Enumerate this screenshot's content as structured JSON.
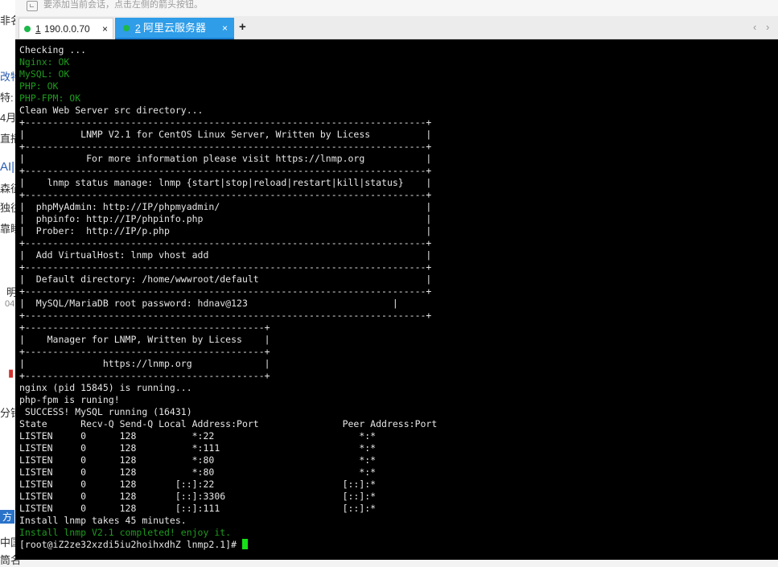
{
  "background": {
    "fragments": [
      "非名",
      "改特",
      "特:",
      "4月",
      "直播",
      "AI|狗",
      "森征",
      "独往",
      "靠睡",
      "明",
      "04",
      "分钟",
      "方",
      "中国",
      "筒名"
    ]
  },
  "hint": {
    "text": "要添加当前会话，点击左侧的箭头按钮。"
  },
  "tabs": [
    {
      "number": "1",
      "title": "190.0.0.70",
      "close": "×",
      "active": false
    },
    {
      "number": "2",
      "title": "阿里云服务器",
      "close": "×",
      "active": true
    }
  ],
  "new_tab_label": "+",
  "scroll_left": "‹",
  "scroll_right": "›",
  "colors": {
    "terminal_bg": "#000000",
    "terminal_text": "#e6e6e6",
    "terminal_green": "#1e9a1e",
    "cursor": "#18e018",
    "active_tab": "#2f9de8",
    "status_dot": "#1db84a"
  },
  "terminal": {
    "lines": [
      {
        "text": "Checking ...",
        "color": "default"
      },
      {
        "text": "Nginx: OK",
        "color": "green"
      },
      {
        "text": "MySQL: OK",
        "color": "green"
      },
      {
        "text": "PHP: OK",
        "color": "green"
      },
      {
        "text": "PHP-FPM: OK",
        "color": "green"
      },
      {
        "text": "Clean Web Server src directory...",
        "color": "default"
      },
      {
        "text": "+------------------------------------------------------------------------+",
        "color": "default"
      },
      {
        "text": "|          LNMP V2.1 for CentOS Linux Server, Written by Licess          |",
        "color": "default"
      },
      {
        "text": "+------------------------------------------------------------------------+",
        "color": "default"
      },
      {
        "text": "|           For more information please visit https://lnmp.org           |",
        "color": "default"
      },
      {
        "text": "+------------------------------------------------------------------------+",
        "color": "default"
      },
      {
        "text": "|    lnmp status manage: lnmp {start|stop|reload|restart|kill|status}    |",
        "color": "default"
      },
      {
        "text": "+------------------------------------------------------------------------+",
        "color": "default"
      },
      {
        "text": "|  phpMyAdmin: http://IP/phpmyadmin/                                     |",
        "color": "default"
      },
      {
        "text": "|  phpinfo: http://IP/phpinfo.php                                        |",
        "color": "default"
      },
      {
        "text": "|  Prober:  http://IP/p.php                                              |",
        "color": "default"
      },
      {
        "text": "+------------------------------------------------------------------------+",
        "color": "default"
      },
      {
        "text": "|  Add VirtualHost: lnmp vhost add                                       |",
        "color": "default"
      },
      {
        "text": "+------------------------------------------------------------------------+",
        "color": "default"
      },
      {
        "text": "|  Default directory: /home/wwwroot/default                              |",
        "color": "default"
      },
      {
        "text": "+------------------------------------------------------------------------+",
        "color": "default"
      },
      {
        "text": "|  MySQL/MariaDB root password: hdnav@123                          |",
        "color": "default"
      },
      {
        "text": "+------------------------------------------------------------------------+",
        "color": "default"
      },
      {
        "text": "+-------------------------------------------+",
        "color": "default"
      },
      {
        "text": "|    Manager for LNMP, Written by Licess    |",
        "color": "default"
      },
      {
        "text": "+-------------------------------------------+",
        "color": "default"
      },
      {
        "text": "|              https://lnmp.org             |",
        "color": "default"
      },
      {
        "text": "+-------------------------------------------+",
        "color": "default"
      },
      {
        "text": "nginx (pid 15845) is running...",
        "color": "default"
      },
      {
        "text": "php-fpm is runing!",
        "color": "default"
      },
      {
        "text": " SUCCESS! MySQL running (16431)",
        "color": "default"
      },
      {
        "text": "State      Recv-Q Send-Q Local Address:Port               Peer Address:Port",
        "color": "default"
      },
      {
        "text": "LISTEN     0      128          *:22                          *:*",
        "color": "default"
      },
      {
        "text": "LISTEN     0      128          *:111                         *:*",
        "color": "default"
      },
      {
        "text": "LISTEN     0      128          *:80                          *:*",
        "color": "default"
      },
      {
        "text": "LISTEN     0      128          *:80                          *:*",
        "color": "default"
      },
      {
        "text": "LISTEN     0      128       [::]:22                       [::]:*",
        "color": "default"
      },
      {
        "text": "LISTEN     0      128       [::]:3306                     [::]:*",
        "color": "default"
      },
      {
        "text": "LISTEN     0      128       [::]:111                      [::]:*",
        "color": "default"
      },
      {
        "text": "Install lnmp takes 45 minutes.",
        "color": "default"
      },
      {
        "text": "Install lnmp V2.1 completed! enjoy it.",
        "color": "green"
      }
    ],
    "prompt": "[root@iZ2ze32xzdi5iu2hoihxdhZ lnmp2.1]# "
  }
}
